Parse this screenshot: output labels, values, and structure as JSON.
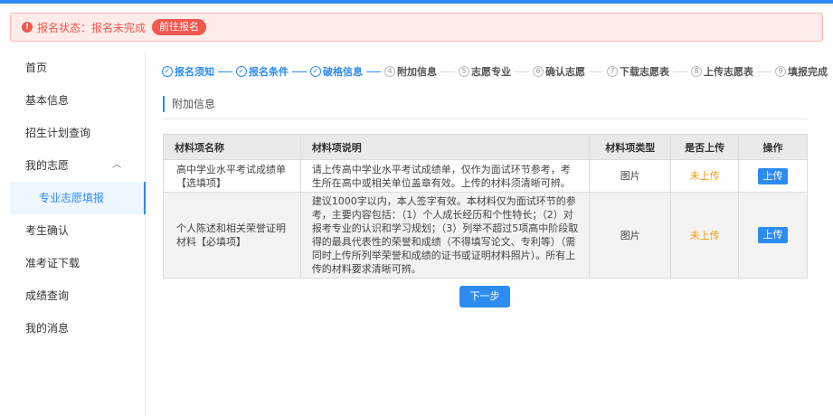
{
  "status": {
    "label": "报名状态：报名未完成",
    "action": "前往报名"
  },
  "sidebar": {
    "items": [
      {
        "label": "首页"
      },
      {
        "label": "基本信息"
      },
      {
        "label": "招生计划查询"
      },
      {
        "label": "我的志愿",
        "expanded": true
      },
      {
        "label": "专业志愿填报",
        "active": true
      },
      {
        "label": "考生确认"
      },
      {
        "label": "准考证下载"
      },
      {
        "label": "成绩查询"
      },
      {
        "label": "我的消息"
      }
    ]
  },
  "steps": [
    {
      "label": "报名须知",
      "state": "done"
    },
    {
      "label": "报名条件",
      "state": "done"
    },
    {
      "label": "破格信息",
      "state": "done"
    },
    {
      "label": "附加信息",
      "num": "4",
      "state": "todo"
    },
    {
      "label": "志愿专业",
      "num": "5",
      "state": "todo"
    },
    {
      "label": "确认志愿",
      "num": "6",
      "state": "todo"
    },
    {
      "label": "下载志愿表",
      "num": "7",
      "state": "todo"
    },
    {
      "label": "上传志愿表",
      "num": "8",
      "state": "todo"
    },
    {
      "label": "填报完成",
      "num": "9",
      "state": "todo"
    }
  ],
  "section": {
    "title": "附加信息"
  },
  "table": {
    "headers": [
      "材料项名称",
      "材料项说明",
      "材料项类型",
      "是否上传",
      "操作"
    ],
    "rows": [
      {
        "name": "高中学业水平考试成绩单【选填项】",
        "desc": "请上传高中学业水平考试成绩单，仅作为面试环节参考，考生所在高中或相关单位盖章有效。上传的材料须清晰可辨。",
        "type": "图片",
        "uploaded": "未上传",
        "action": "上传"
      },
      {
        "name": "个人陈述和相关荣誉证明材料【必填项】",
        "desc": "建议1000字以内，本人签字有效。本材料仅为面试环节的参考，主要内容包括：（1）个人成长经历和个性特长；（2）对报考专业的认识和学习规划；（3）列举不超过5项高中阶段取得的最具代表性的荣誉和成绩（不得填写论文、专利等）（需同时上传所列举荣誉和成绩的证书或证明材料照片）。所有上传的材料要求清晰可辨。",
        "type": "图片",
        "uploaded": "未上传",
        "action": "上传"
      }
    ]
  },
  "footer": {
    "next_label": "下一步"
  },
  "colors": {
    "primary": "#2d8cf0",
    "danger": "#f4574b",
    "warning": "#f39c12"
  }
}
